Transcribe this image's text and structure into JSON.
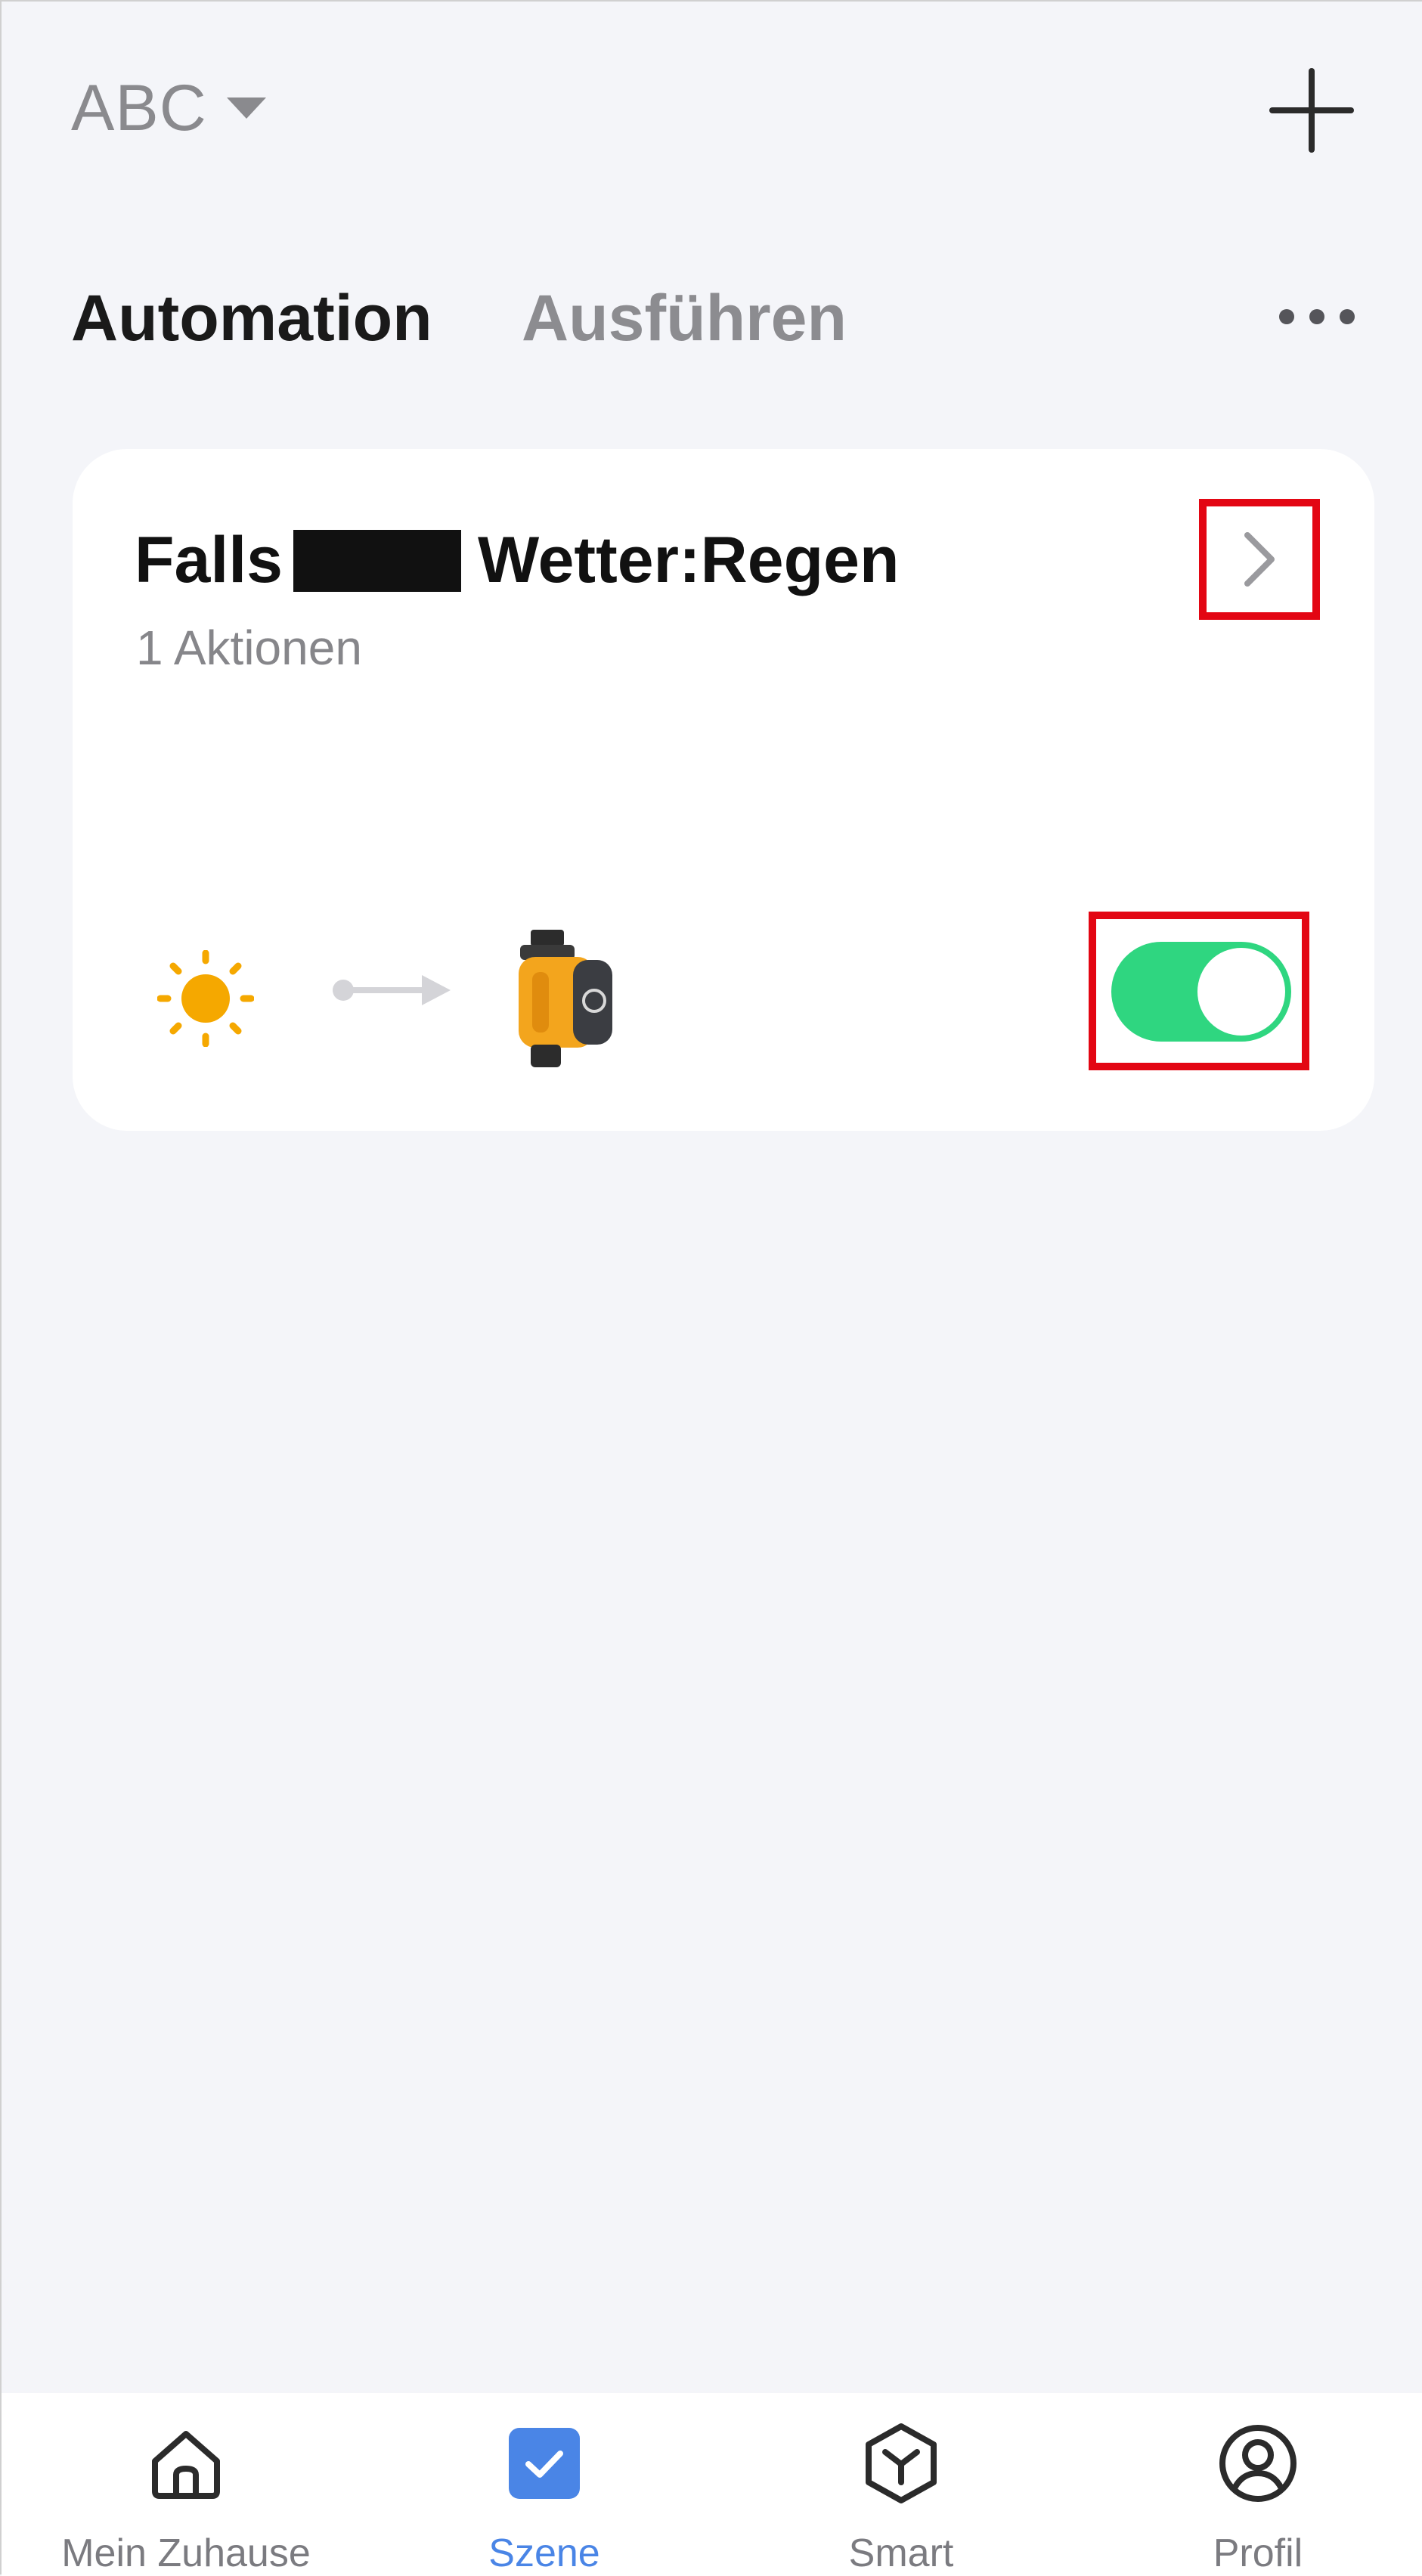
{
  "header": {
    "home_name": "ABC"
  },
  "tabs": [
    {
      "label": "Automation",
      "active": true
    },
    {
      "label": "Ausführen",
      "active": false
    }
  ],
  "automation_card": {
    "title_prefix": "Falls",
    "title_suffix": "Wetter:Regen",
    "subtitle": "1 Aktionen",
    "enabled": true,
    "condition_icon": "sun-icon",
    "action_icon": "water-valve-device-icon"
  },
  "bottom_nav": [
    {
      "label": "Mein Zuhause",
      "icon": "home-icon",
      "active": false
    },
    {
      "label": "Szene",
      "icon": "scene-check-icon",
      "active": true
    },
    {
      "label": "Smart",
      "icon": "smart-cube-icon",
      "active": false
    },
    {
      "label": "Profil",
      "icon": "profile-icon",
      "active": false
    }
  ],
  "colors": {
    "background": "#f4f5f9",
    "toggle_on": "#2fd680",
    "highlight_box": "#e30613",
    "nav_active": "#4a85e6",
    "sun": "#f5a800"
  }
}
